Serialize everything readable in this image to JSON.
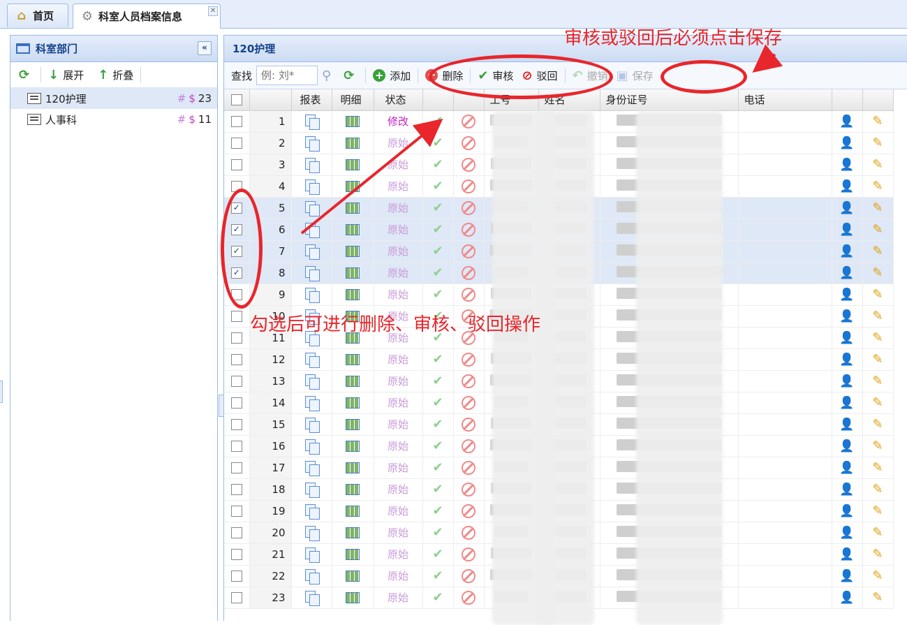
{
  "tabs": [
    {
      "label": "首页",
      "icon": "home-icon"
    },
    {
      "label": "科室人员档案信息",
      "icon": "gear-icon"
    }
  ],
  "left_panel": {
    "title": "科室部门",
    "toolbar": {
      "expand": "展开",
      "collapse": "折叠"
    },
    "tree": [
      {
        "label": "120护理",
        "hash": "#",
        "dollar": "$",
        "count": "23",
        "selected": true
      },
      {
        "label": "人事科",
        "hash": "#",
        "dollar": "$",
        "count": "11",
        "selected": false
      }
    ]
  },
  "main": {
    "title": "120护理",
    "toolbar": {
      "search_label": "查找",
      "search_placeholder": "例: 刘*",
      "add": "添加",
      "delete": "删除",
      "approve": "审核",
      "reject": "驳回",
      "undo": "撤销",
      "save": "保存"
    },
    "columns": [
      "报表",
      "明细",
      "状态",
      "",
      "",
      "工号",
      "姓名",
      "身份证号",
      "电话"
    ],
    "rows": [
      {
        "n": "1",
        "status": "修改",
        "checked": false
      },
      {
        "n": "2",
        "status": "原始",
        "checked": false
      },
      {
        "n": "3",
        "status": "原始",
        "checked": false
      },
      {
        "n": "4",
        "status": "原始",
        "checked": false
      },
      {
        "n": "5",
        "status": "原始",
        "checked": true
      },
      {
        "n": "6",
        "status": "原始",
        "checked": true
      },
      {
        "n": "7",
        "status": "原始",
        "checked": true
      },
      {
        "n": "8",
        "status": "原始",
        "checked": true
      },
      {
        "n": "9",
        "status": "原始",
        "checked": false
      },
      {
        "n": "10",
        "status": "原始",
        "checked": false
      },
      {
        "n": "11",
        "status": "原始",
        "checked": false
      },
      {
        "n": "12",
        "status": "原始",
        "checked": false
      },
      {
        "n": "13",
        "status": "原始",
        "checked": false
      },
      {
        "n": "14",
        "status": "原始",
        "checked": false
      },
      {
        "n": "15",
        "status": "原始",
        "checked": false
      },
      {
        "n": "16",
        "status": "原始",
        "checked": false
      },
      {
        "n": "17",
        "status": "原始",
        "checked": false
      },
      {
        "n": "18",
        "status": "原始",
        "checked": false
      },
      {
        "n": "19",
        "status": "原始",
        "checked": false
      },
      {
        "n": "20",
        "status": "原始",
        "checked": false
      },
      {
        "n": "21",
        "status": "原始",
        "checked": false
      },
      {
        "n": "22",
        "status": "原始",
        "checked": false
      },
      {
        "n": "23",
        "status": "原始",
        "checked": false
      }
    ]
  },
  "annotations": {
    "top_note": "审核或驳回后必须点击保存",
    "middle_note": "勾选后可进行删除、审核、驳回操作"
  },
  "colors": {
    "accent": "#15428b",
    "annotation": "#e8262b",
    "status_modified": "#c020c0",
    "status_original": "#c89ad8"
  }
}
